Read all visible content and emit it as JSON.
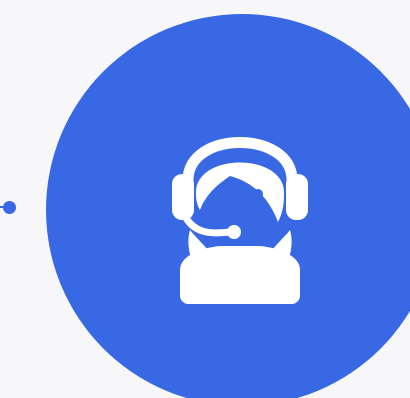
{
  "icon": {
    "name": "customer-support-agent-icon"
  },
  "colors": {
    "accent": "#3868e3",
    "background": "#f7f7f9",
    "foreground": "#ffffff"
  }
}
